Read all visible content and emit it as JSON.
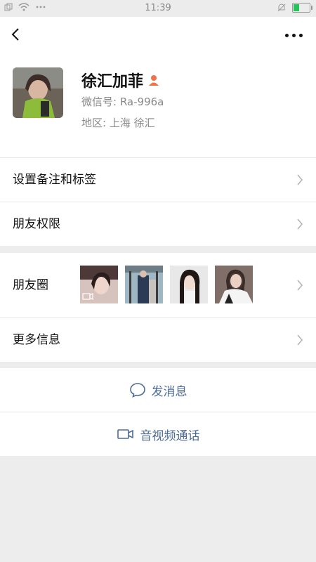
{
  "status_bar": {
    "time": "11:39",
    "battery_percent": 0.35
  },
  "profile": {
    "name": "徐汇加菲",
    "wechat_id": "微信号: Ra-996a",
    "region": "地区: 上海  徐汇"
  },
  "rows": {
    "remarks_tags": "设置备注和标签",
    "friend_permissions": "朋友权限",
    "moments": "朋友圈",
    "more_info": "更多信息"
  },
  "actions": {
    "send_message": "发消息",
    "video_call": "音视频通话"
  },
  "icons": {
    "back": "back-chevron-icon",
    "more": "more-dots-icon",
    "person": "person-icon",
    "chat": "chat-bubble-icon",
    "video": "video-camera-icon"
  },
  "colors": {
    "link": "#4c6b97",
    "person_badge": "#f0724a",
    "battery": "#25c35a"
  }
}
